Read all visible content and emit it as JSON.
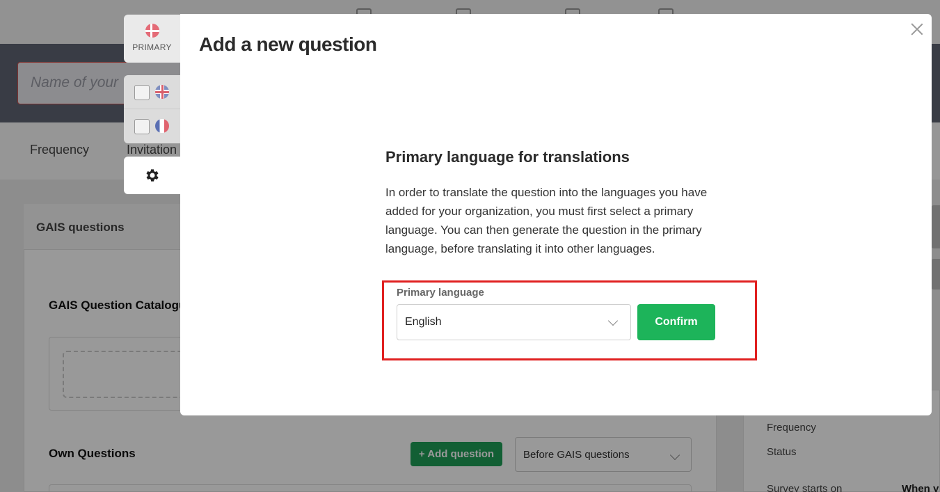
{
  "background": {
    "name_placeholder": "Name of your",
    "tabs": [
      "Frequency",
      "Invitation"
    ],
    "card_title": "GAIS questions",
    "catalogue_title": "GAIS Question Catalogu",
    "own_questions_title": "Own Questions",
    "add_question_label": "+ Add question",
    "position_select_value": "Before GAIS questions",
    "side_labels": [
      "Frequency",
      "Status",
      "Survey starts on"
    ],
    "side_value": "When y"
  },
  "languages": {
    "primary_label": "PRIMARY",
    "primary_flag": "denmark-flag-icon",
    "others": [
      {
        "flag": "uk-flag-icon",
        "checked": false
      },
      {
        "flag": "france-flag-icon",
        "checked": false
      }
    ],
    "settings_icon": "gear-icon"
  },
  "modal": {
    "title": "Add a new question",
    "section_title": "Primary language for translations",
    "description": "In order to translate the question into the languages you have added for your organization, you must first select a primary language. You can then generate the question in the primary language, before translating it into other languages.",
    "field_label": "Primary language",
    "selected_language": "English",
    "confirm_label": "Confirm"
  },
  "colors": {
    "confirm": "#1db45a",
    "highlight": "#e02020",
    "overlay": "rgba(0,0,0,0.40)"
  }
}
